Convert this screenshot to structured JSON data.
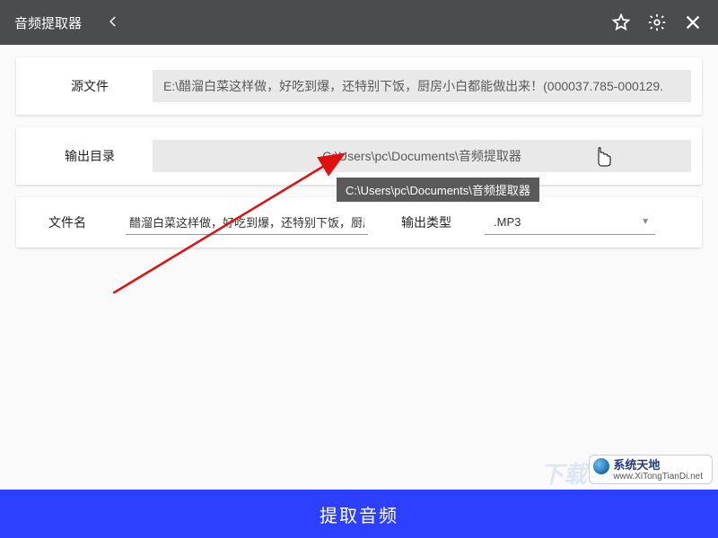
{
  "titlebar": {
    "title": "音频提取器"
  },
  "source": {
    "label": "源文件",
    "value": "E:\\醋溜白菜这样做，好吃到爆，还特别下饭，厨房小白都能做出来！(000037.785-000129."
  },
  "output_dir": {
    "label": "输出目录",
    "value": "C:\\Users\\pc\\Documents\\音频提取器"
  },
  "tooltip": "C:\\Users\\pc\\Documents\\音频提取器",
  "filename": {
    "label": "文件名",
    "value": "醋溜白菜这样做，好吃到爆，还特别下饭，厨房小白"
  },
  "output_type": {
    "label": "输出类型",
    "value": ".MP3"
  },
  "extract_button": "提取音频",
  "watermark": {
    "name": "系统天地",
    "url": "www.XiTongTianDi.net"
  }
}
